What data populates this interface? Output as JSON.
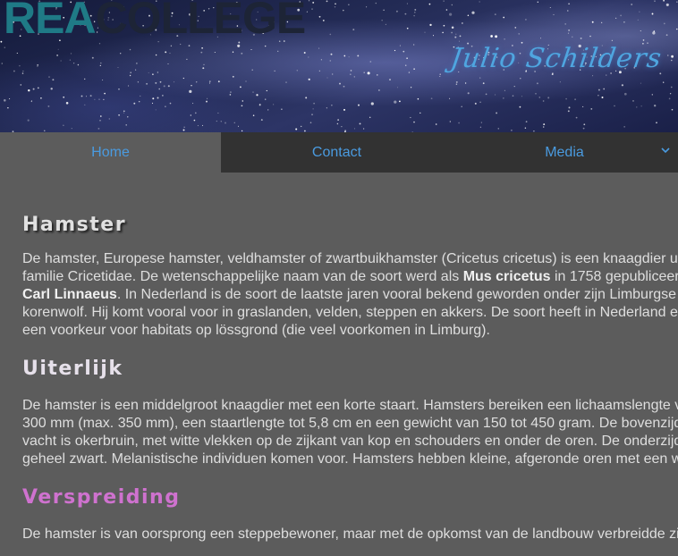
{
  "header": {
    "logo_part1": "REA",
    "logo_part2": "COLLEGE",
    "author": "Julio Schilders"
  },
  "nav": {
    "tabs": [
      {
        "label": "Home",
        "active": true
      },
      {
        "label": "Contact",
        "active": false
      },
      {
        "label": "Media",
        "active": false,
        "has_dropdown": true
      }
    ],
    "dropdown_icon": "chevron-down-icon"
  },
  "sections": [
    {
      "heading": "Hamster",
      "lines": [
        [
          "De hamster, Europese hamster, veldhamster of zwartbuikhamster (Cricetus cricetus) is een knaagdier uit"
        ],
        [
          "familie Cricetidae. De wetenschappelijke naam van de soort werd als ",
          {
            "b": "Mus cricetus"
          },
          " in 1758 gepubliceer"
        ],
        [
          {
            "b": "Carl Linnaeus"
          },
          ". In Nederland is de soort de laatste jaren vooral bekend geworden onder zijn Limburgse"
        ],
        [
          "korenwolf. Hij komt vooral voor in graslanden, velden, steppen en akkers. De soort heeft in Nederland en"
        ],
        [
          "een voorkeur voor habitats op lössgrond (die veel voorkomen in Limburg)."
        ]
      ]
    },
    {
      "heading": "Uiterlijk",
      "lines": [
        [
          "De hamster is een middelgroot knaagdier met een korte staart. Hamsters bereiken een lichaamslengte v"
        ],
        [
          "300 mm (max. 350 mm), een staartlengte tot 5,8 cm en een gewicht van 150 tot 450 gram. De bovenzijde"
        ],
        [
          "vacht is okerbruin, met witte vlekken op de zijkant van kop en schouders en onder de oren. De onderzijd"
        ],
        [
          "geheel zwart. Melanistische individuen komen voor. Hamsters hebben kleine, afgeronde oren met een w"
        ]
      ]
    },
    {
      "heading": "Verspreiding",
      "lines": [
        [
          "De hamster is van oorsprong een steppebewoner, maar met de opkomst van de landbouw verbreidde zi"
        ]
      ]
    }
  ],
  "colors": {
    "nav_text": "#4a9be0",
    "heading_pink": "#cf72cf",
    "author": "#4fa6e0",
    "logo_teal": "#1f7a86"
  }
}
